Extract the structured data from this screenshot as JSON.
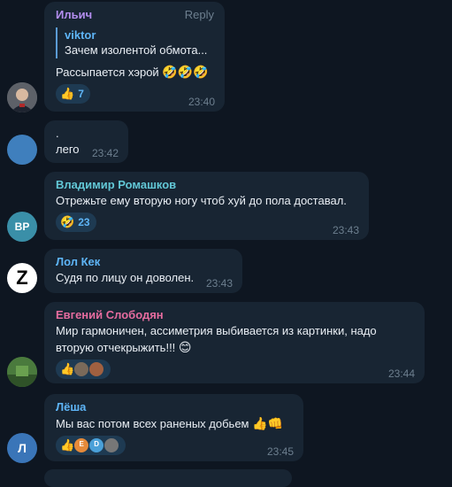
{
  "messages": [
    {
      "author": "Ильич",
      "reply_label": "Reply",
      "quote_author": "viktor",
      "quote_text": "Зачем изолентой обмота...",
      "text": "Рассыпается хэрой",
      "emojis": "🤣🤣🤣",
      "reaction_emoji": "👍",
      "reaction_count": "7",
      "time": "23:40",
      "author_color": "#b48ef0"
    },
    {
      "author": "",
      "line1": ".",
      "line2": "лего",
      "time": "23:42",
      "avatar_color": "#3f7fbd"
    },
    {
      "author": "Владимир Ромашков",
      "text": "Отрежьте ему вторую ногу чтоб хуй до пола доставал.",
      "reaction_emoji": "🤣",
      "reaction_count": "23",
      "time": "23:43",
      "avatar_initials": "ВР",
      "avatar_color": "#3a8fa8",
      "author_color": "#62c7d6"
    },
    {
      "author": "Лол Кек",
      "text": "Судя по лицу он доволен.",
      "time": "23:43",
      "avatar_letter": "Z",
      "author_color": "#5eb5f7"
    },
    {
      "author": "Евгений Слободян",
      "text_line1": "Мир гармоничен, ассиметрия выбивается из картинки, надо",
      "text_line2": "вторую отчекрыжить!!!",
      "emoji": "😊",
      "reaction_emoji": "👍",
      "time": "23:44",
      "author_color": "#e66c9f"
    },
    {
      "author": "Лёша",
      "text": "Мы вас потом всех раненых добьем",
      "emojis": "👍👊",
      "reaction_emoji": "👍",
      "mini_avatar_letters": [
        "E",
        "D"
      ],
      "time": "23:45",
      "avatar_letter": "Л",
      "avatar_color": "#3a75b8",
      "author_color": "#5eb5f7"
    }
  ]
}
